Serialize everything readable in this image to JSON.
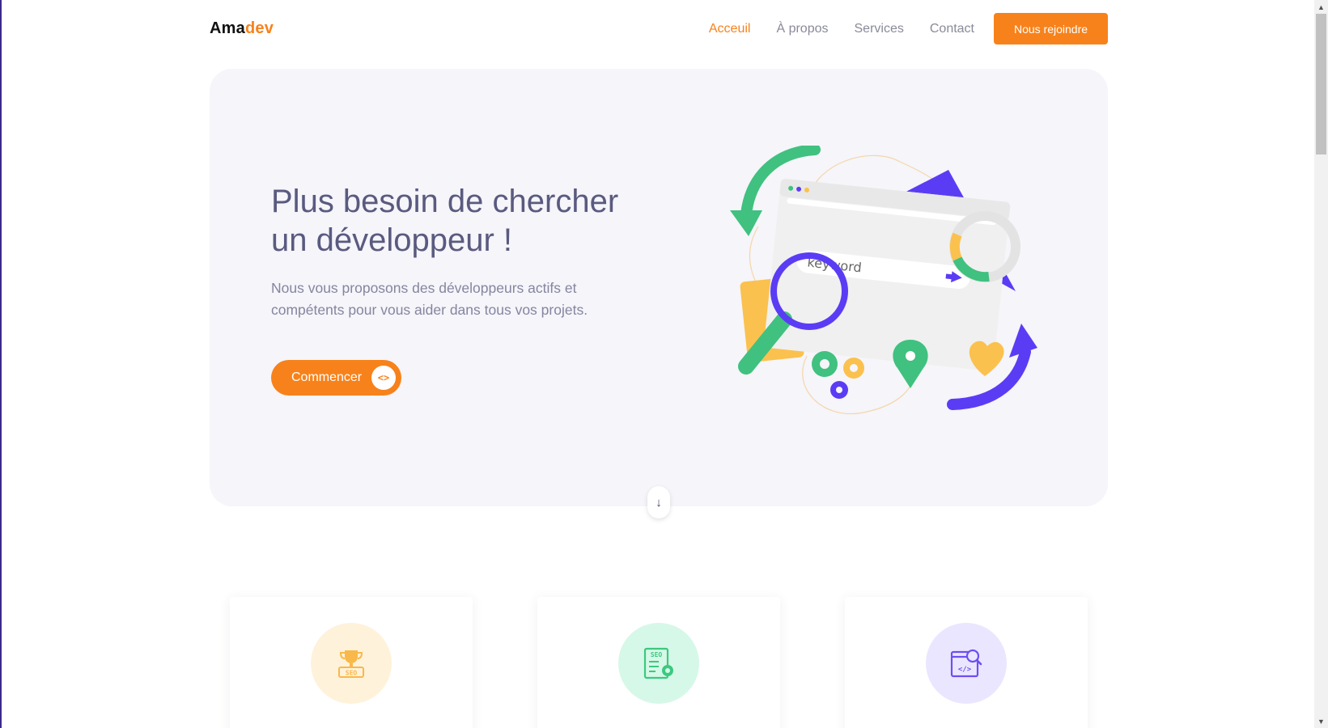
{
  "brand": {
    "logo_main": "Ama",
    "logo_accent": "dev",
    "accent_color": "#f7821b",
    "text_color": "#5a5a80"
  },
  "nav": {
    "items": [
      {
        "label": "Acceuil",
        "active": true
      },
      {
        "label": "À propos",
        "active": false
      },
      {
        "label": "Services",
        "active": false
      },
      {
        "label": "Contact",
        "active": false
      }
    ],
    "cta_label": "Nous rejoindre"
  },
  "hero": {
    "title": "Plus besoin de chercher un développeur !",
    "description": "Nous vous proposons des développeurs actifs et compétents pour vous aider dans tous vos projets.",
    "cta_label": "Commencer",
    "cta_icon": "code-brackets-icon",
    "cta_icon_glyph": "<>",
    "illustration_search_text": "keyword",
    "illustration_colors": {
      "purple": "#5b3cf5",
      "green": "#40c17f",
      "yellow": "#fbc14e"
    },
    "scroll_icon": "arrow-down-icon",
    "scroll_glyph": "↓"
  },
  "services": {
    "cards": [
      {
        "icon": "seo-trophy-icon",
        "icon_color": "#f9b84a",
        "bg_color": "#fff2da"
      },
      {
        "icon": "seo-report-icon",
        "icon_color": "#3cc97f",
        "bg_color": "#d6f8e8"
      },
      {
        "icon": "code-search-icon",
        "icon_color": "#6d4ff0",
        "bg_color": "#ebe6ff"
      }
    ]
  },
  "scrollbar": {
    "up_glyph": "▲",
    "down_glyph": "▼"
  }
}
